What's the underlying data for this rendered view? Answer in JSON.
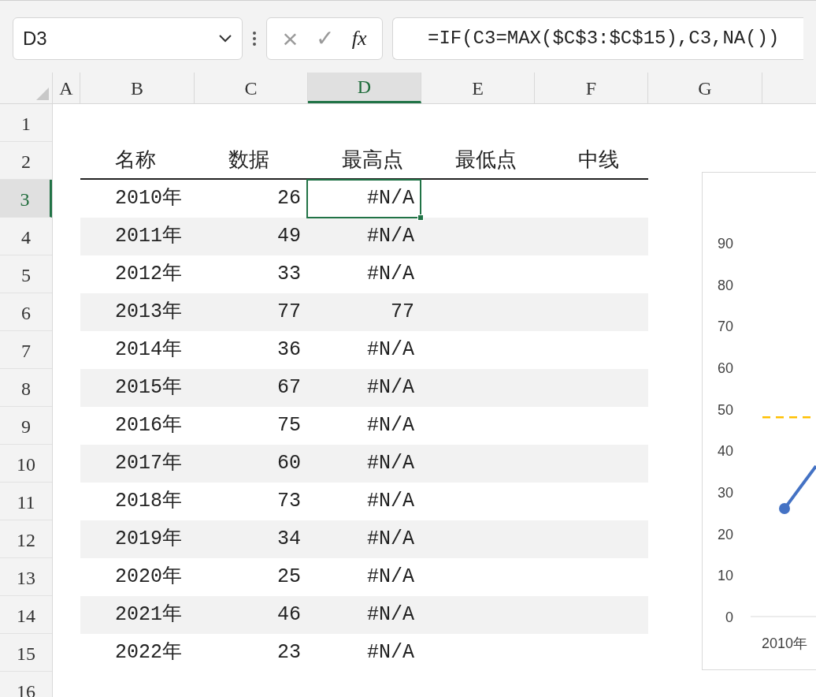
{
  "name_box": {
    "value": "D3"
  },
  "formula_bar": {
    "cancel": "×",
    "confirm": "✓",
    "fx": "fx",
    "value": "=IF(C3=MAX($C$3:$C$15),C3,NA())"
  },
  "columns": [
    {
      "label": "A",
      "selected": false
    },
    {
      "label": "B",
      "selected": false
    },
    {
      "label": "C",
      "selected": false
    },
    {
      "label": "D",
      "selected": true
    },
    {
      "label": "E",
      "selected": false
    },
    {
      "label": "F",
      "selected": false
    },
    {
      "label": "G",
      "selected": false
    }
  ],
  "row_numbers": [
    {
      "label": "1",
      "selected": false
    },
    {
      "label": "2",
      "selected": false
    },
    {
      "label": "3",
      "selected": true
    },
    {
      "label": "4",
      "selected": false
    },
    {
      "label": "5",
      "selected": false
    },
    {
      "label": "6",
      "selected": false
    },
    {
      "label": "7",
      "selected": false
    },
    {
      "label": "8",
      "selected": false
    },
    {
      "label": "9",
      "selected": false
    },
    {
      "label": "10",
      "selected": false
    },
    {
      "label": "11",
      "selected": false
    },
    {
      "label": "12",
      "selected": false
    },
    {
      "label": "13",
      "selected": false
    },
    {
      "label": "14",
      "selected": false
    },
    {
      "label": "15",
      "selected": false
    },
    {
      "label": "16",
      "selected": false
    }
  ],
  "table": {
    "columns": [
      "名称",
      "数据",
      "最高点",
      "最低点",
      "中线"
    ],
    "rows": [
      {
        "name": "2010年",
        "value": "26",
        "max": "#N/A",
        "selected": true
      },
      {
        "name": "2011年",
        "value": "49",
        "max": "#N/A",
        "selected": false
      },
      {
        "name": "2012年",
        "value": "33",
        "max": "#N/A",
        "selected": false
      },
      {
        "name": "2013年",
        "value": "77",
        "max": "77",
        "selected": false
      },
      {
        "name": "2014年",
        "value": "36",
        "max": "#N/A",
        "selected": false
      },
      {
        "name": "2015年",
        "value": "67",
        "max": "#N/A",
        "selected": false
      },
      {
        "name": "2016年",
        "value": "75",
        "max": "#N/A",
        "selected": false
      },
      {
        "name": "2017年",
        "value": "60",
        "max": "#N/A",
        "selected": false
      },
      {
        "name": "2018年",
        "value": "73",
        "max": "#N/A",
        "selected": false
      },
      {
        "name": "2019年",
        "value": "34",
        "max": "#N/A",
        "selected": false
      },
      {
        "name": "2020年",
        "value": "25",
        "max": "#N/A",
        "selected": false
      },
      {
        "name": "2021年",
        "value": "46",
        "max": "#N/A",
        "selected": false
      },
      {
        "name": "2022年",
        "value": "23",
        "max": "#N/A",
        "selected": false
      }
    ]
  },
  "chart": {
    "chart_data": {
      "type": "line",
      "categories": [
        "2010年"
      ],
      "ylim": [
        0,
        90
      ],
      "yticks": [
        0,
        10,
        20,
        30,
        40,
        50,
        60,
        70,
        80,
        90
      ],
      "series": [
        {
          "color": "#4472c4",
          "values": [
            26
          ],
          "marker": true
        }
      ],
      "ref_lines": [
        {
          "axis": "y",
          "value": 48,
          "color": "#ffc000",
          "line_style": "dashed"
        }
      ]
    }
  }
}
